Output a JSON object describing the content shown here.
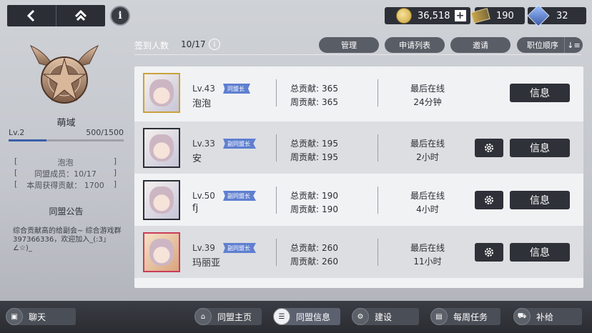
{
  "currency": {
    "coins": "36,518",
    "plus": "+",
    "tickets": "190",
    "gems": "32"
  },
  "guild": {
    "name": "萌域",
    "level": "Lv.2",
    "exp": "500/1500",
    "exp_fraction": 0.33,
    "leader_value": "泡泡",
    "members_label": "同盟成员：",
    "members_value": "10/17",
    "weekly_label": "本周获得贡献：",
    "weekly_value": "1700",
    "notice_title": "同盟公告",
    "notice_text": "综合贡献高的给副会~ 综合游戏群397366336，欢迎加入_(:3」∠☆)_"
  },
  "header": {
    "signin_label": "签到人数",
    "signin_count": "10/17",
    "manage": "管理",
    "apply_list": "申请列表",
    "invite": "邀请",
    "sort": "职位顺序"
  },
  "members": [
    {
      "level": "Lv.43",
      "name": "泡泡",
      "role": "同盟长",
      "total_label": "总贡献:",
      "total": "365",
      "weekly_label": "周贡献:",
      "weekly": "365",
      "online_label": "最后在线",
      "online": "24分钟",
      "info": "信息"
    },
    {
      "level": "Lv.33",
      "name": "安",
      "role": "副同盟长",
      "total_label": "总贡献:",
      "total": "195",
      "weekly_label": "周贡献:",
      "weekly": "195",
      "online_label": "最后在线",
      "online": "2小时",
      "info": "信息"
    },
    {
      "level": "Lv.50",
      "name": "fj",
      "role": "副同盟长",
      "total_label": "总贡献:",
      "total": "190",
      "weekly_label": "周贡献:",
      "weekly": "190",
      "online_label": "最后在线",
      "online": "4小时",
      "info": "信息"
    },
    {
      "level": "Lv.39",
      "name": "玛丽亚",
      "role": "副同盟长",
      "total_label": "总贡献:",
      "total": "260",
      "weekly_label": "周贡献:",
      "weekly": "260",
      "online_label": "最后在线",
      "online": "11小时",
      "info": "信息"
    }
  ],
  "bottom_tabs": [
    {
      "label": "聊天"
    },
    {
      "label": "同盟主页"
    },
    {
      "label": "同盟信息"
    },
    {
      "label": "建设"
    },
    {
      "label": "每周任务"
    },
    {
      "label": "补给"
    }
  ]
}
